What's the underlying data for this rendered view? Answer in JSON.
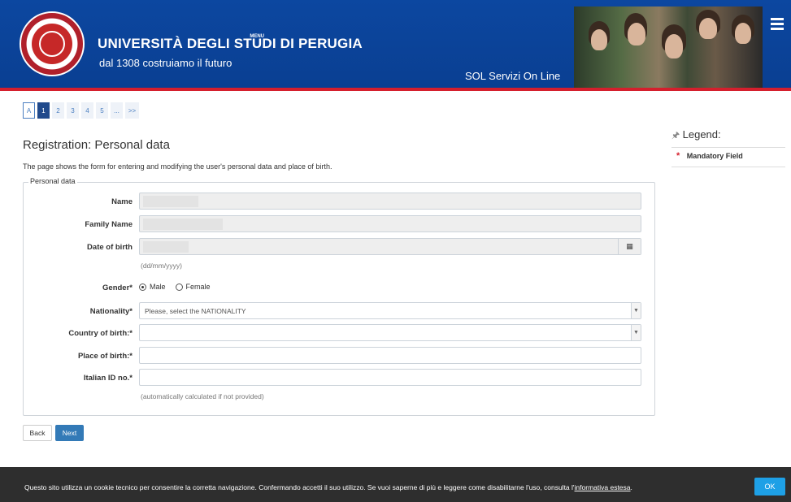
{
  "header": {
    "university_name": "UNIVERSITÀ DEGLI STUDI DI PERUGIA",
    "tagline": "dal 1308 costruiamo il futuro",
    "service_label": "SOL Servizi On Line",
    "menu_label": "MENU"
  },
  "steps": {
    "items": [
      "A",
      "1",
      "2",
      "3",
      "4",
      "5",
      "...",
      ">>"
    ],
    "active": "1"
  },
  "page": {
    "title": "Registration: Personal data",
    "description": "The page shows the form for entering and modifying the user's personal data and place of birth."
  },
  "legend": {
    "title": "Legend:",
    "mandatory_symbol": "*",
    "mandatory_label": "Mandatory Field"
  },
  "form": {
    "fieldset_label": "Personal data",
    "name_label": "Name",
    "family_name_label": "Family Name",
    "dob_label": "Date of birth",
    "dob_hint": "(dd/mm/yyyy)",
    "gender_label": "Gender*",
    "gender_options": [
      "Male",
      "Female"
    ],
    "gender_selected": "Male",
    "nationality_label": "Nationality*",
    "nationality_value": "Please, select the NATIONALITY",
    "country_label": "Country of birth:*",
    "country_value": "",
    "place_label": "Place of birth:*",
    "place_value": "",
    "id_label": "Italian ID no.*",
    "id_value": "",
    "id_hint": "(automatically calculated if not provided)"
  },
  "buttons": {
    "back": "Back",
    "next": "Next"
  },
  "cookie": {
    "text": "Questo sito utilizza un cookie tecnico per consentire la corretta navigazione. Confermando accetti il suo utilizzo. Se vuoi saperne di più e leggere come disabilitarne l'uso, consulta l'",
    "link": "informativa estesa",
    "suffix": ".",
    "ok": "OK"
  },
  "colors": {
    "header_blue": "#0c47a0",
    "header_red_line": "#d51f2d",
    "primary_button": "#337ab7",
    "cookie_ok": "#1ea0e6"
  }
}
